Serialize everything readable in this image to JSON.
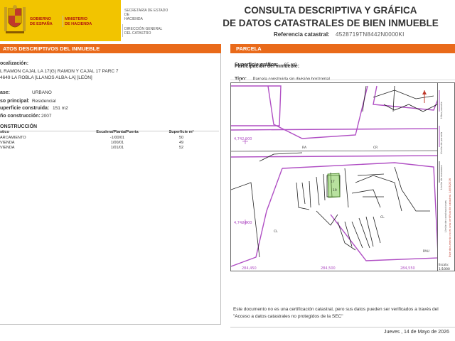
{
  "header": {
    "gov_line1": "GOBIERNO",
    "gov_line2": "DE ESPAÑA",
    "ministry_line1": "MINISTERIO",
    "ministry_line2": "DE HACIENDA",
    "secr_line1": "SECRETARÍA DE ESTADO",
    "secr_line2": "DE",
    "secr_line3": "HACIENDA",
    "dirgen_line1": "DIRECCIÓN GENERAL",
    "dirgen_line2": "DEL CATASTRO",
    "title_line1": "CONSULTA DESCRIPTIVA Y GRÁFICA",
    "title_line2": "DE DATOS CATASTRALES DE BIEN INMUEBLE",
    "refcat_label": "Referencia catastral:",
    "refcat_value": "4528719TN8442N0000KI"
  },
  "left": {
    "section_title": "ATOS DESCRIPTIVOS DEL INMUEBLE",
    "localizacion_label": "ocalización:",
    "address_line1": "L RAMON CAJAL LA 17(G) RAMON Y CAJAL 17  PARC 7",
    "address_line2": "4649 LA ROBLA [LLANOS ALBA-LA] [LEÓN]",
    "clase_label": "ase:",
    "clase_value": "URBANO",
    "uso_label": "so principal:",
    "uso_value": "Residencial",
    "superficie_label": "uperficie construida:",
    "superficie_value": "151 m2",
    "anio_label": "ño construcción:",
    "anio_value": "2007",
    "construccion_title": "ONSTRUCCIÓN",
    "table_headers": [
      "stico",
      "Escalera/Planta/Puerta",
      "Superficie m²"
    ],
    "table_rows": [
      [
        "ARCAMIENTO",
        "-1/00/01",
        "50"
      ],
      [
        "VIENDA",
        "1/00/01",
        "49"
      ],
      [
        "VIENDA",
        "1/01/01",
        "52"
      ]
    ]
  },
  "right": {
    "section_title": "PARCELA",
    "sup_grafica_label": "Superficie gráfica:",
    "sup_grafica_value": "65 m2",
    "participacion_label": "Participación del inmueble:",
    "participacion_value": "",
    "tipo_label": "Tipo:",
    "tipo_value": "Parcela construida sin división horizontal",
    "map_title": "PARCELA",
    "coord_y1": "4,742,900",
    "coord_y2": "4,742,800",
    "coord_x1": "284,450",
    "coord_x2": "284,500",
    "coord_x3": "284,550",
    "map_labels": [
      "RA",
      "CR",
      "CL",
      "CL",
      "PAU",
      "17",
      "19"
    ],
    "scale_label": "Escala:",
    "scale_value": "1/1000",
    "legend": [
      "Hitos parcela",
      "Límite de parcela",
      "Límite de manzana",
      "Límite de construcciones"
    ],
    "legend_side": "Este documento no es una certificación catastral. 14/05/2026",
    "colors": {
      "accent": "#e96a1a",
      "parcel_outline": "#b04fc4",
      "highlight": "#7ec850"
    }
  },
  "footer": {
    "disclaimer": "Este documento no es una certificación catastral, pero sus datos pueden ser verificados a través del \"Acceso a datos catastrales no protegidos de la SEC\"",
    "date": "Jueves , 14 de Mayo de 2026"
  }
}
